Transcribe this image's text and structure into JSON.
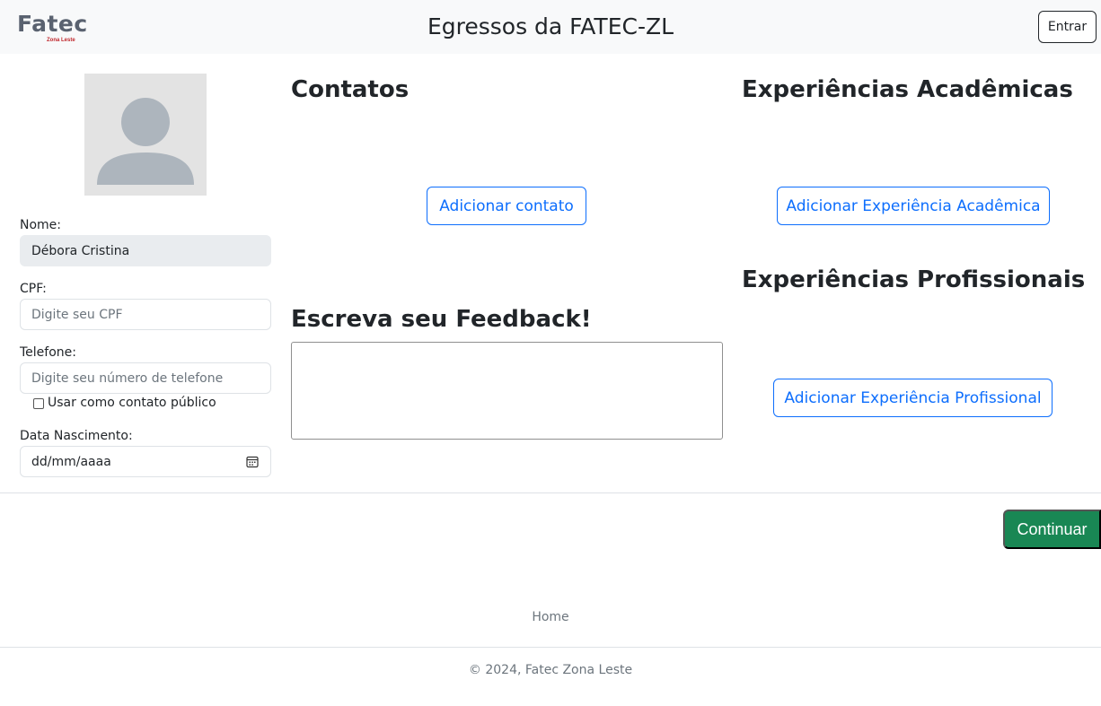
{
  "header": {
    "logo_text": "Fatec",
    "logo_subtext": "Zona Leste",
    "title": "Egressos da FATEC-ZL",
    "login_label": "Entrar"
  },
  "profile": {
    "avatar_icon": "user-silhouette-icon",
    "name_label": "Nome:",
    "name_value": "Débora Cristina",
    "cpf_label": "CPF:",
    "cpf_placeholder": "Digite seu CPF",
    "phone_label": "Telefone:",
    "phone_placeholder": "Digite seu número de telefone",
    "public_contact_label": "Usar como contato público",
    "birth_label": "Data Nascimento:",
    "birth_placeholder": "dd/mm/aaaa"
  },
  "contacts": {
    "heading": "Contatos",
    "add_button": "Adicionar contato"
  },
  "feedback": {
    "heading": "Escreva seu Feedback!"
  },
  "academic": {
    "heading": "Experiências Acadêmicas",
    "add_button": "Adicionar Experiência Acadêmica"
  },
  "professional": {
    "heading": "Experiências Profissionais",
    "add_button": "Adicionar Experiência Profissional"
  },
  "actions": {
    "continue_label": "Continuar"
  },
  "footer": {
    "home_link": "Home",
    "copyright": "© 2024, Fatec Zona Leste"
  },
  "colors": {
    "primary": "#0d6efd",
    "success": "#198754",
    "brand_red": "#c0282d"
  }
}
